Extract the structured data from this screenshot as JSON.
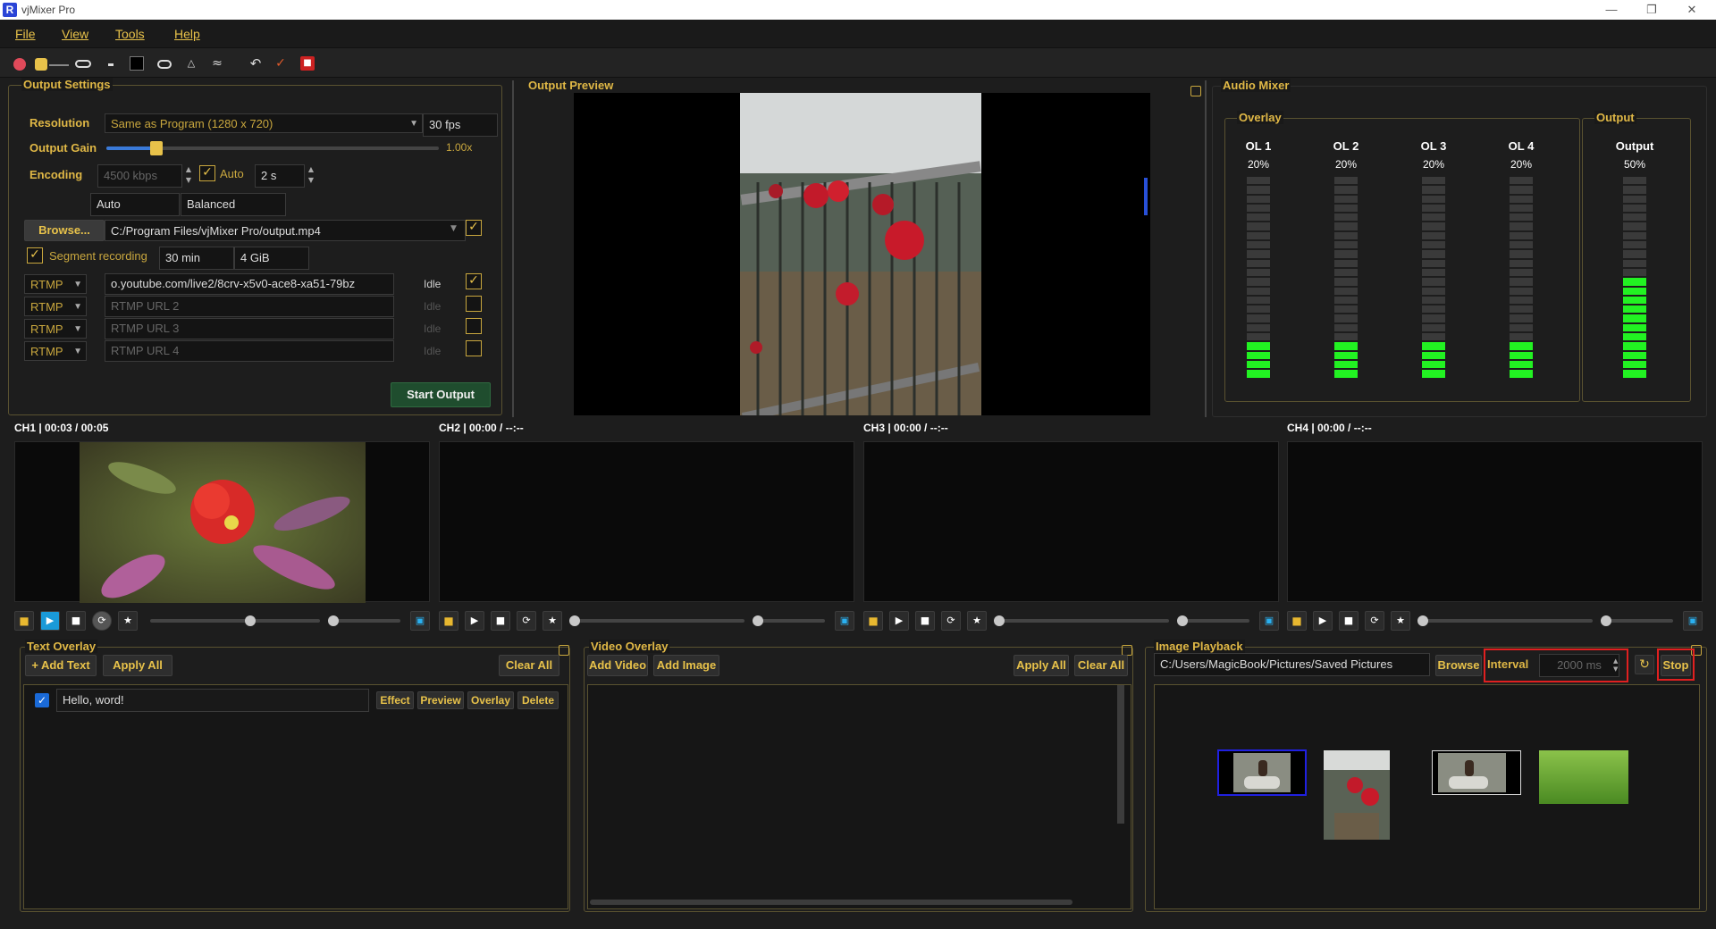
{
  "app": {
    "title": "vjMixer Pro",
    "logo_letter": "R"
  },
  "menu": [
    "File",
    "View",
    "Tools",
    "Help"
  ],
  "toolbar_icons": [
    "palette-icon",
    "brush-color-icon",
    "line-icon",
    "pen-icon",
    "dot-icon",
    "fill-square-icon",
    "ellipse-icon",
    "triangle-icon",
    "wave-icon",
    "undo-icon",
    "brush-icon",
    "save-icon"
  ],
  "output_settings": {
    "title": "Output Settings",
    "resolution_label": "Resolution",
    "resolution_value": "Same as Program (1280 x 720)",
    "fps_value": "30 fps",
    "gain_label": "Output Gain",
    "gain_value": "1.00x",
    "gain_level": 0.15,
    "encoding_label": "Encoding",
    "bitrate_value": "4500 kbps",
    "auto_label": "Auto",
    "keyframe_value": "2 s",
    "encoder_value": "Auto",
    "preset_value": "Balanced",
    "browse_label": "Browse...",
    "output_path": "C:/Program Files/vjMixer Pro/output.mp4",
    "segment_label": "Segment recording",
    "segment_time": "30 min",
    "segment_size": "4 GiB",
    "rtmp_rows": [
      {
        "type": "RTMP",
        "url": "o.youtube.com/live2/8crv-x5v0-ace8-xa51-79bz",
        "status": "Idle",
        "enabled": true,
        "placeholder": false
      },
      {
        "type": "RTMP",
        "url": "RTMP URL 2",
        "status": "Idle",
        "enabled": false,
        "placeholder": true
      },
      {
        "type": "RTMP",
        "url": "RTMP URL 3",
        "status": "Idle",
        "enabled": false,
        "placeholder": true
      },
      {
        "type": "RTMP",
        "url": "RTMP URL 4",
        "status": "Idle",
        "enabled": false,
        "placeholder": true
      }
    ],
    "start_label": "Start Output"
  },
  "output_preview": {
    "title": "Output Preview"
  },
  "audio_mixer": {
    "title": "Audio Mixer",
    "overlay_title": "Overlay",
    "output_title": "Output",
    "channels": [
      {
        "name": "OL 1",
        "pct": "20%",
        "level": 0.2
      },
      {
        "name": "OL 2",
        "pct": "20%",
        "level": 0.2
      },
      {
        "name": "OL 3",
        "pct": "20%",
        "level": 0.2
      },
      {
        "name": "OL 4",
        "pct": "20%",
        "level": 0.2
      }
    ],
    "output": {
      "name": "Output",
      "pct": "50%",
      "level": 0.5
    }
  },
  "channels": [
    {
      "header": "CH1 | 00:03 / 00:05",
      "progress": 0.6
    },
    {
      "header": "CH2 | 00:00 / --:--",
      "progress": 0.0
    },
    {
      "header": "CH3 | 00:00 / --:--",
      "progress": 0.0
    },
    {
      "header": "CH4 | 00:00 / --:--",
      "progress": 0.0
    }
  ],
  "text_overlay": {
    "title": "Text Overlay",
    "add_label": "+ Add Text",
    "apply_label": "Apply All",
    "clear_label": "Clear All",
    "item_text": "Hello, word!",
    "effect_label": "Effect",
    "preview_label": "Preview",
    "overlay_label": "Overlay",
    "delete_label": "Delete"
  },
  "video_overlay": {
    "title": "Video Overlay",
    "add_video_label": "Add Video",
    "add_image_label": "Add Image",
    "apply_label": "Apply All",
    "clear_label": "Clear All"
  },
  "image_playback": {
    "title": "Image Playback",
    "folder": "C:/Users/MagicBook/Pictures/Saved Pictures",
    "browse_label": "Browse",
    "interval_label": "Interval",
    "interval_value": "2000 ms",
    "stop_label": "Stop"
  },
  "colors": {
    "accent": "#e0b846",
    "meter_on": "#22f222",
    "highlight": "#e02020"
  }
}
